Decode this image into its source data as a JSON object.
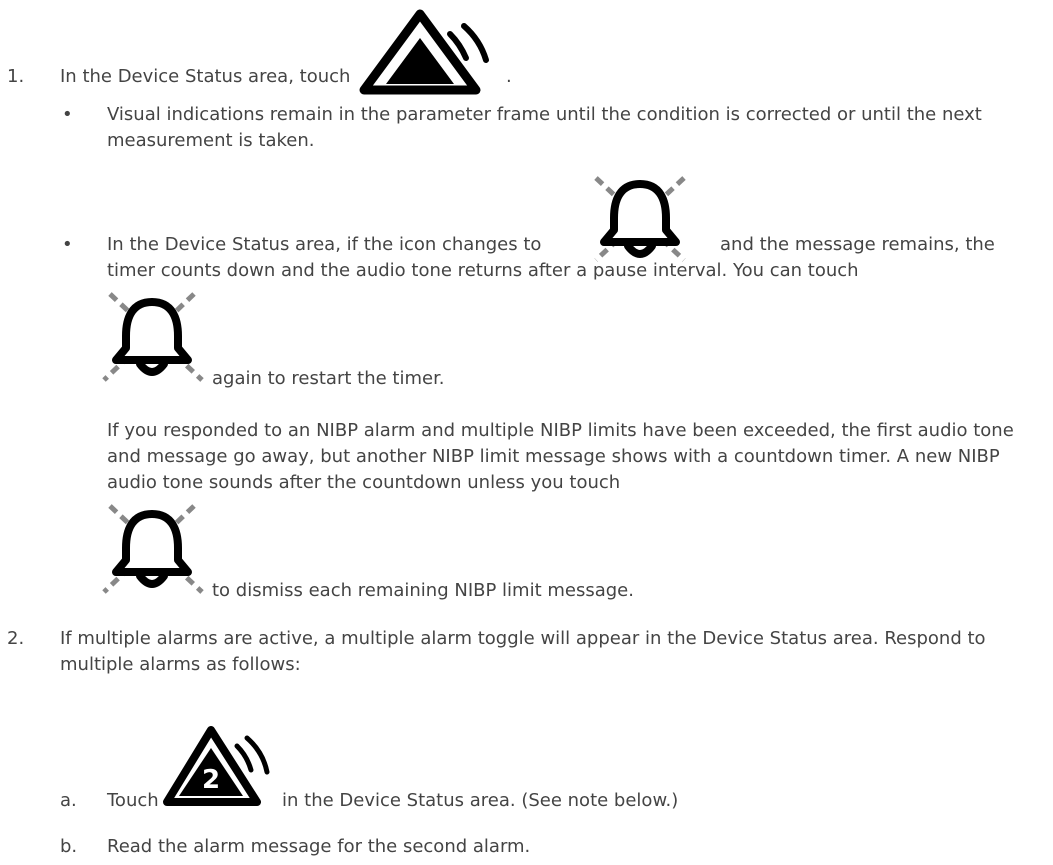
{
  "steps": [
    {
      "number": "1.",
      "intro": "In the Device Status area, touch",
      "intro_end": ".",
      "icons": {
        "acknowledge": "alarm-triangle-icon",
        "paused": "alarm-bell-paused-icon"
      },
      "bullets": [
        {
          "marker": "•",
          "text": "Visual indications remain in the parameter frame until the condition is corrected or until the next measurement is taken."
        },
        {
          "marker": "•",
          "text_before_icon": "In the Device Status area, if the icon changes to",
          "text_after_icon": "and the message remains, the",
          "line2": "timer counts down and the audio tone returns after a pause interval. You can touch",
          "text_restart": "again to restart the timer.",
          "nibp_paragraph": "If you responded to an NIBP alarm and multiple NIBP limits have been exceeded, the first audio tone and message go away, but another NIBP limit message shows with a countdown timer. A new NIBP audio tone sounds after the countdown unless you touch",
          "text_dismiss": "to dismiss each remaining NIBP limit message."
        }
      ]
    },
    {
      "number": "2.",
      "text": "If multiple alarms are active, a multiple alarm toggle will appear in the Device Status area. Respond to multiple alarms as follows:",
      "substeps": [
        {
          "marker": "a.",
          "text_before_icon": "Touch",
          "icon": "alarm-toggle-2-icon",
          "icon_number": "2",
          "text_after_icon": "in the Device Status area. (See note below.)"
        },
        {
          "marker": "b.",
          "text": "Read the alarm message for the second alarm."
        }
      ]
    }
  ]
}
